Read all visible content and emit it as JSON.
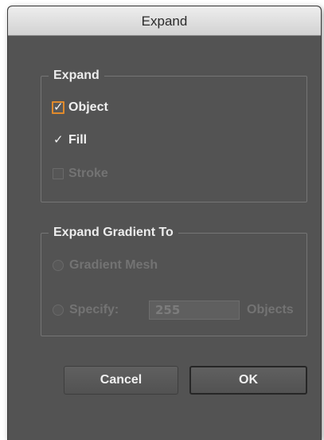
{
  "window": {
    "title": "Expand"
  },
  "expand_group": {
    "label": "Expand",
    "options": [
      {
        "label": "Object",
        "checked": true,
        "enabled": true,
        "focused": true
      },
      {
        "label": "Fill",
        "checked": true,
        "enabled": true,
        "focused": false
      },
      {
        "label": "Stroke",
        "checked": false,
        "enabled": false,
        "focused": false
      }
    ]
  },
  "gradient_group": {
    "label": "Expand Gradient To",
    "gradient_mesh_label": "Gradient Mesh",
    "specify_label": "Specify:",
    "specify_value": "255",
    "objects_label": "Objects"
  },
  "buttons": {
    "cancel": "Cancel",
    "ok": "OK"
  },
  "colors": {
    "dialog_background": "#535353",
    "focus_ring": "#e08a2c"
  },
  "icons": {
    "check": "check-mark-icon"
  }
}
